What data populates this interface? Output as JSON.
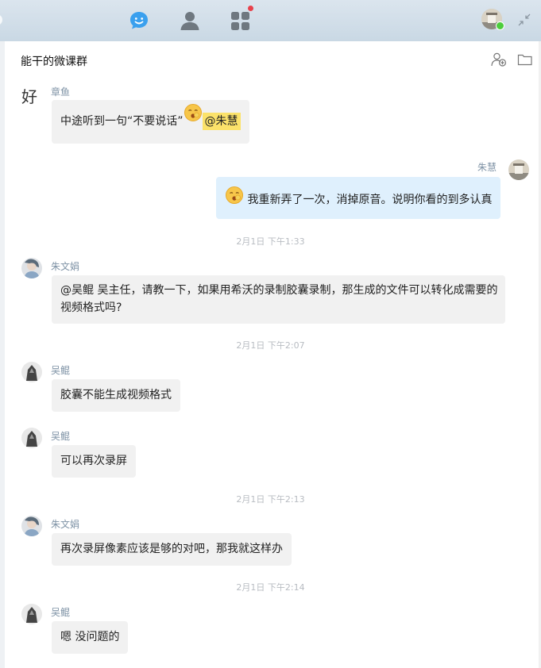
{
  "group": {
    "title": "能干的微课群"
  },
  "colors": {
    "topbar": "#cfdce7",
    "self_bubble": "#dff0fd",
    "other_bubble": "#f1f1f1",
    "online": "#4ccd3d",
    "mention": "#fbe26a"
  },
  "icons": {
    "nav": [
      "chat-icon",
      "contacts-icon",
      "apps-icon"
    ],
    "header": [
      "add-member-icon",
      "folder-icon"
    ],
    "window": "shrink-icon"
  },
  "messages": [
    {
      "sender": "章鱼",
      "avatar_char": "好",
      "text": "中途听到一句“不要说话”",
      "mention": "@朱慧"
    },
    {
      "sender": "朱慧",
      "text": "我重新弄了一次，消掉原音。说明你看的到多认真"
    },
    {
      "timestamp": "2月1日  下午1:33"
    },
    {
      "sender": "朱文娟",
      "line1": "@吴鲲 吴主任，请教一下，如果用希沃的录制胶囊录制，那生成的文件可以转化成需要的",
      "line2": "视频格式吗?"
    },
    {
      "timestamp": "2月1日  下午2:07"
    },
    {
      "sender": "吴鲲",
      "text": "胶囊不能生成视频格式"
    },
    {
      "sender": "吴鲲",
      "text": "可以再次录屏"
    },
    {
      "timestamp": "2月1日  下午2:13"
    },
    {
      "sender": "朱文娟",
      "text": "再次录屏像素应该是够的对吧，那我就这样办"
    },
    {
      "timestamp": "2月1日  下午2:14"
    },
    {
      "sender": "吴鲲",
      "text": "嗯 没问题的"
    }
  ]
}
